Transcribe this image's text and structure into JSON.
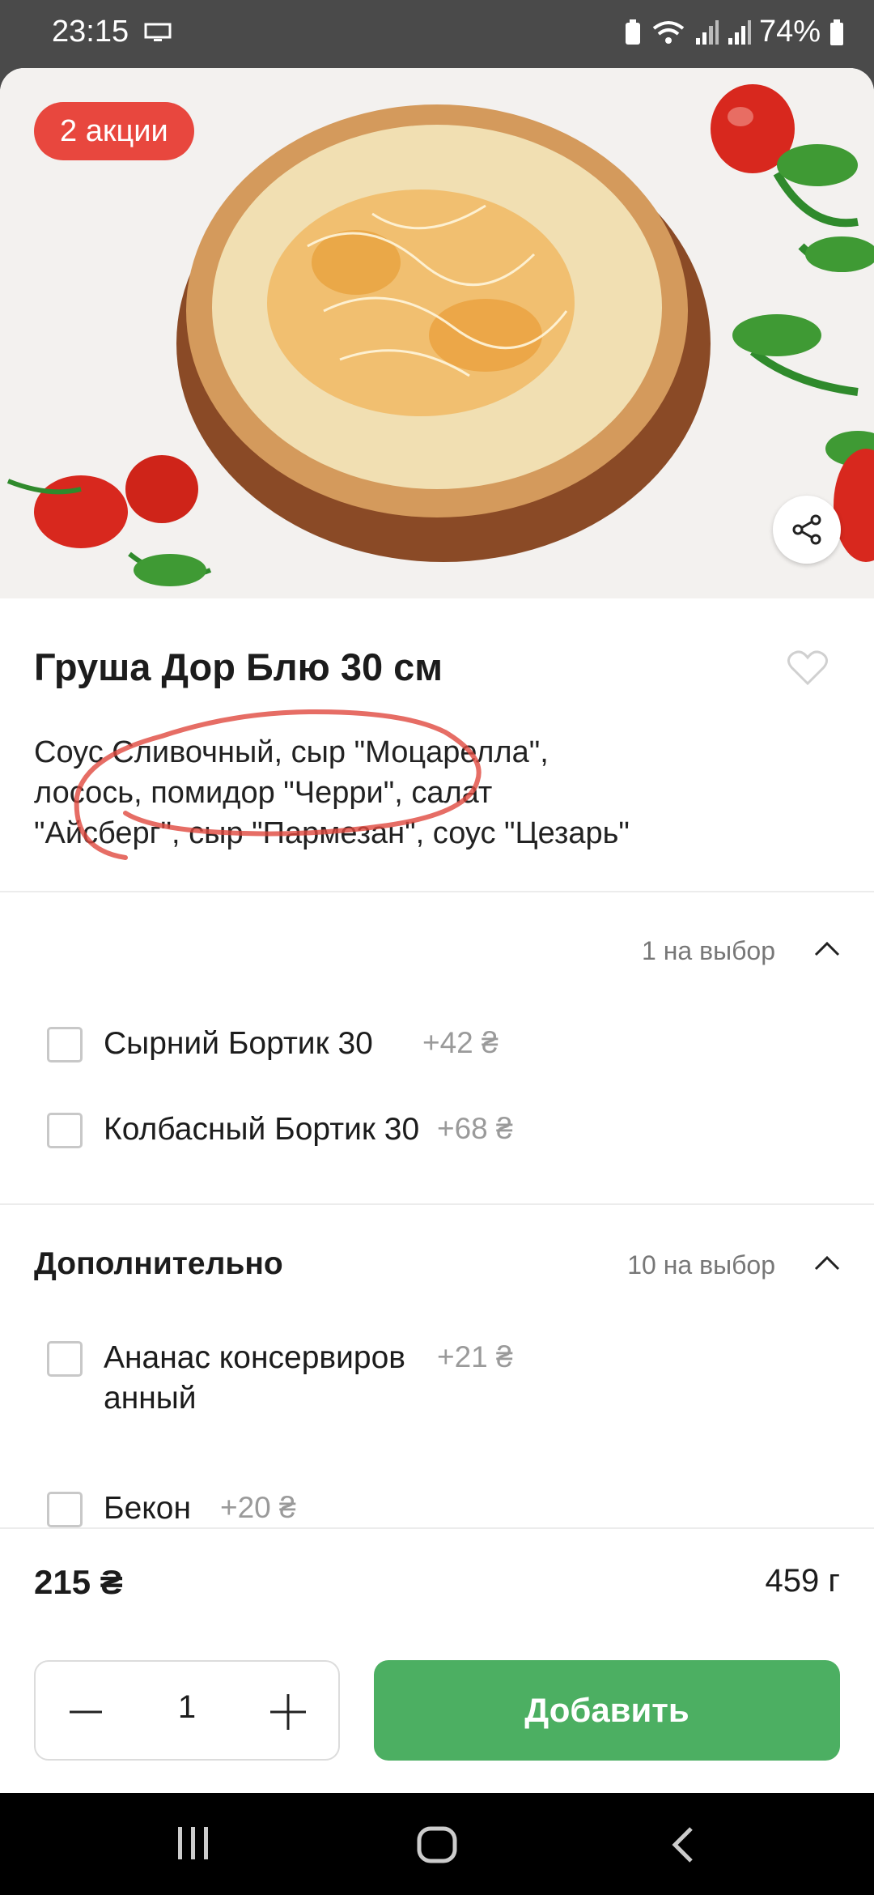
{
  "status_bar": {
    "time": "23:15",
    "battery": "74%"
  },
  "hero": {
    "promo_badge": "2 акции"
  },
  "product": {
    "title": "Груша Дор Блю 30 см",
    "description_lines": [
      "Соус Сливочный, сыр \"Моцарелла\",",
      "лосось, помидор \"Черри\", салат",
      "\"Айсберг\", сыр \"Пармезан\", соус \"Цезарь\""
    ]
  },
  "crust_section": {
    "count_label": "1 на выбор",
    "options": [
      {
        "label": "Сырний Бортик 30",
        "price": "+42 ₴",
        "checked": false
      },
      {
        "label": "Колбасный Бортик 30",
        "price": "+68 ₴",
        "checked": false
      }
    ]
  },
  "extras_section": {
    "title": "Дополнительно",
    "count_label": "10 на выбор",
    "options": [
      {
        "label": "Ананас консервированный",
        "price": "+21 ₴",
        "checked": false
      },
      {
        "label": "Бекон",
        "price": "+20 ₴",
        "checked": false
      }
    ]
  },
  "footer": {
    "price": "215 ₴",
    "weight": "459 г",
    "quantity": "1",
    "add_label": "Добавить"
  },
  "colors": {
    "accent_green": "#4caf62",
    "promo_red": "#e8473e"
  }
}
